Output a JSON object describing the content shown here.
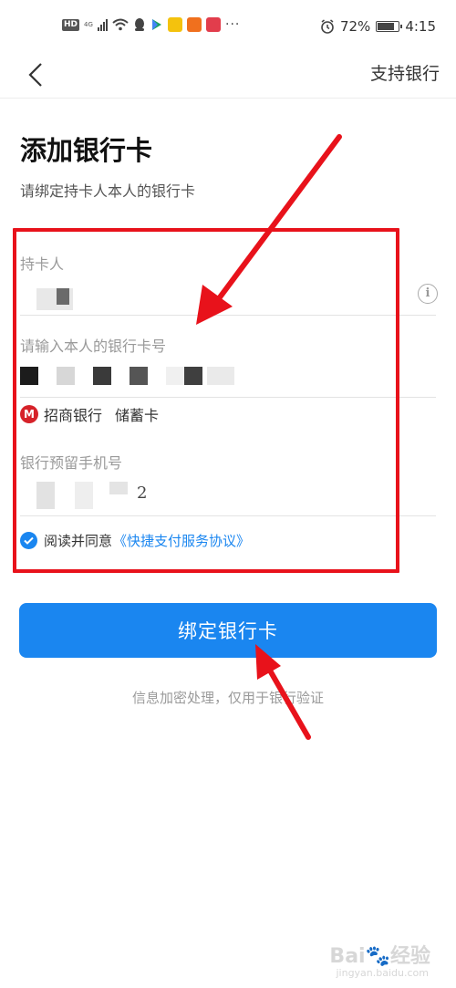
{
  "status_bar": {
    "hd": "HD",
    "net": "4G",
    "battery_percent_text": "72%",
    "battery_level": 0.72,
    "time": "4:15",
    "more": "···"
  },
  "nav": {
    "back_icon": "chevron-left-icon",
    "support_label": "支持银行"
  },
  "page": {
    "title": "添加银行卡",
    "subtitle": "请绑定持卡人本人的银行卡"
  },
  "form": {
    "cardholder_label": "持卡人",
    "card_number_label": "请输入本人的银行卡号",
    "bank_name": "招商银行",
    "card_type": "储蓄卡",
    "phone_label": "银行预留手机号",
    "phone_value_visible": "2",
    "agree_text": "阅读并同意",
    "agree_link": "《快捷支付服务协议》"
  },
  "actions": {
    "bind_label": "绑定银行卡",
    "hint": "信息加密处理，仅用于银行验证"
  },
  "watermark": {
    "brand": "Bai",
    "brand_cn": "经验",
    "url": "jingyan.baidu.com"
  },
  "colors": {
    "accent": "#1a86f0",
    "annotation_red": "#e8121b",
    "bank_red": "#d62229"
  }
}
